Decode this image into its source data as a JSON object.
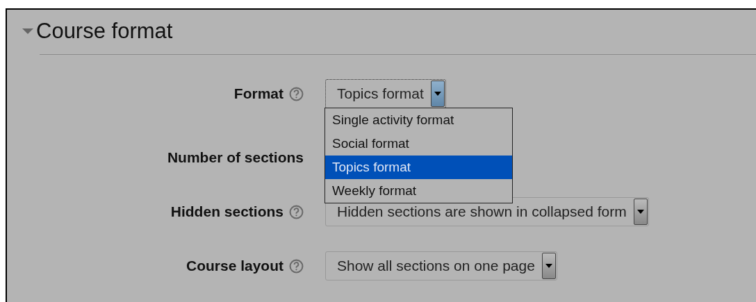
{
  "section": {
    "title": "Course format",
    "expanded": true
  },
  "fields": [
    {
      "label": "Format",
      "help": true,
      "value": "Topics format",
      "focused": true,
      "open": true,
      "options": [
        {
          "label": "Single activity format",
          "selected": false
        },
        {
          "label": "Social format",
          "selected": false
        },
        {
          "label": "Topics format",
          "selected": true
        },
        {
          "label": "Weekly format",
          "selected": false
        }
      ]
    },
    {
      "label": "Number of sections",
      "help": false
    },
    {
      "label": "Hidden sections",
      "help": true,
      "value": "Hidden sections are shown in collapsed form",
      "focused": false,
      "open": false
    },
    {
      "label": "Course layout",
      "help": true,
      "value": "Show all sections on one page",
      "focused": false,
      "open": false
    }
  ]
}
